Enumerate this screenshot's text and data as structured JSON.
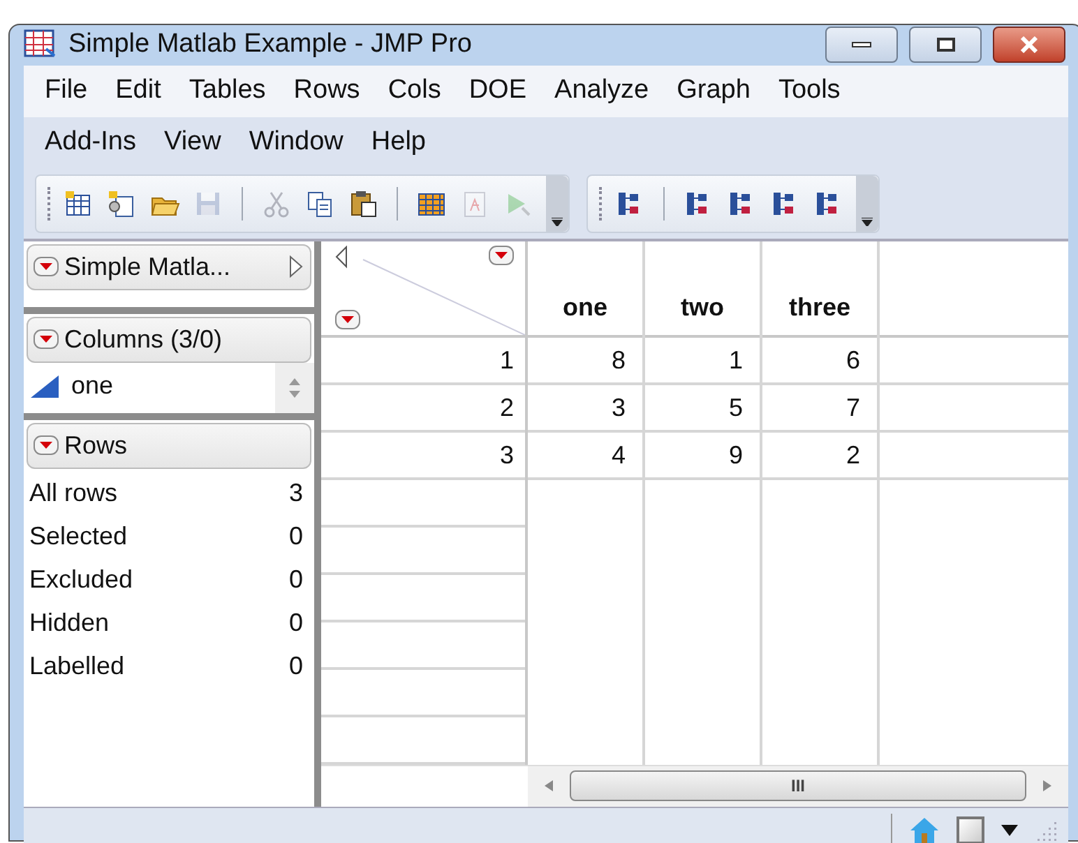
{
  "window": {
    "title": "Simple Matlab Example - JMP Pro"
  },
  "menu_rows": [
    [
      "File",
      "Edit",
      "Tables",
      "Rows",
      "Cols",
      "DOE",
      "Analyze",
      "Graph",
      "Tools"
    ],
    [
      "Add-Ins",
      "View",
      "Window",
      "Help"
    ]
  ],
  "toolbars": [
    [
      {
        "kind": "new-table",
        "disabled": false
      },
      {
        "kind": "new-script",
        "disabled": false
      },
      {
        "kind": "open",
        "disabled": false
      },
      {
        "kind": "save",
        "disabled": true
      },
      {
        "kind": "sep"
      },
      {
        "kind": "cut",
        "disabled": true
      },
      {
        "kind": "copy",
        "disabled": false
      },
      {
        "kind": "paste",
        "disabled": false
      },
      {
        "kind": "sep"
      },
      {
        "kind": "table",
        "disabled": false
      },
      {
        "kind": "report",
        "disabled": true
      },
      {
        "kind": "run",
        "disabled": true
      }
    ],
    [
      {
        "kind": "tree",
        "disabled": false
      },
      {
        "kind": "sep"
      },
      {
        "kind": "tree",
        "disabled": false
      },
      {
        "kind": "tree",
        "disabled": false
      },
      {
        "kind": "tree",
        "disabled": false
      },
      {
        "kind": "tree",
        "disabled": false
      }
    ]
  ],
  "table_panel": {
    "title": "Simple Matla..."
  },
  "columns_panel": {
    "title": "Columns (3/0)",
    "items": [
      {
        "name": "one"
      }
    ]
  },
  "rows_panel": {
    "title": "Rows",
    "stats": [
      {
        "label": "All rows",
        "value": "3"
      },
      {
        "label": "Selected",
        "value": "0"
      },
      {
        "label": "Excluded",
        "value": "0"
      },
      {
        "label": "Hidden",
        "value": "0"
      },
      {
        "label": "Labelled",
        "value": "0"
      }
    ]
  },
  "table": {
    "columns": [
      "one",
      "two",
      "three"
    ],
    "rows": [
      {
        "number": "1",
        "cells": [
          "8",
          "1",
          "6"
        ]
      },
      {
        "number": "2",
        "cells": [
          "3",
          "5",
          "7"
        ]
      },
      {
        "number": "3",
        "cells": [
          "4",
          "9",
          "2"
        ]
      }
    ]
  },
  "scrollbar": {
    "grip": "III"
  },
  "status_bar": {
    "checked": false
  }
}
